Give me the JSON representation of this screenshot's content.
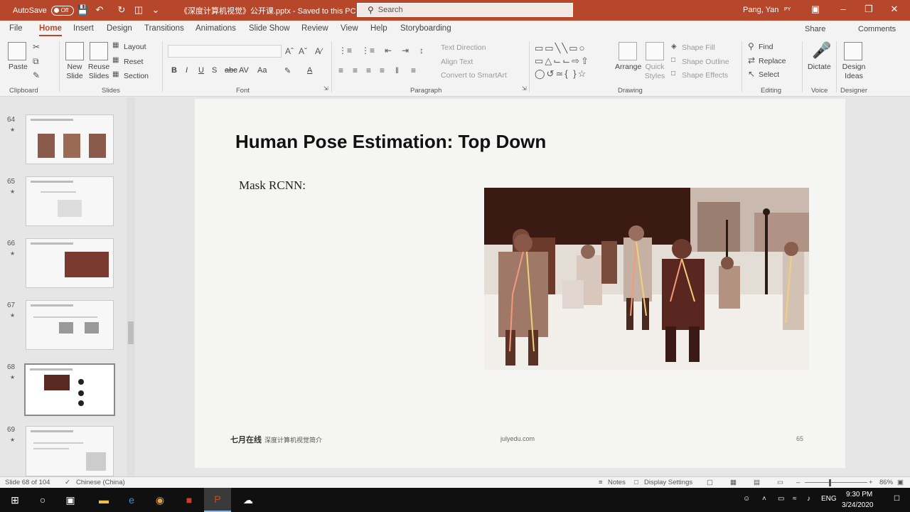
{
  "titlebar": {
    "autosave_label": "AutoSave",
    "autosave_state": "Off",
    "doc_title": "《深度计算机视觉》公开课.pptx  -  Saved to this PC",
    "search_placeholder": "Search",
    "user_name": "Pang, Yan",
    "user_initials": "PY"
  },
  "tabs": [
    "File",
    "Home",
    "Insert",
    "Design",
    "Transitions",
    "Animations",
    "Slide Show",
    "Review",
    "View",
    "Help",
    "Storyboarding"
  ],
  "share": {
    "share_label": "Share",
    "comments_label": "Comments"
  },
  "ribbon": {
    "clipboard": {
      "paste": "Paste",
      "label": "Clipboard"
    },
    "slides": {
      "new_slide": "New Slide",
      "reuse_slides": "Reuse Slides",
      "layout": "Layout",
      "reset": "Reset",
      "section": "Section",
      "label": "Slides"
    },
    "font": {
      "label": "Font"
    },
    "paragraph": {
      "text_direction": "Text Direction",
      "align_text": "Align Text",
      "convert_smartart": "Convert to SmartArt",
      "label": "Paragraph"
    },
    "drawing": {
      "arrange": "Arrange",
      "quick_styles": "Quick Styles",
      "shape_fill": "Shape Fill",
      "shape_outline": "Shape Outline",
      "shape_effects": "Shape Effects",
      "label": "Drawing"
    },
    "editing": {
      "find": "Find",
      "replace": "Replace",
      "select": "Select",
      "label": "Editing"
    },
    "voice": {
      "dictate": "Dictate",
      "label": "Voice"
    },
    "designer": {
      "design_ideas": "Design Ideas",
      "label": "Designer"
    }
  },
  "thumbnails": [
    {
      "num": "64",
      "star": "★"
    },
    {
      "num": "65",
      "star": "★"
    },
    {
      "num": "66",
      "star": "★"
    },
    {
      "num": "67",
      "star": "★"
    },
    {
      "num": "68",
      "star": "★"
    },
    {
      "num": "69",
      "star": "★"
    }
  ],
  "slide": {
    "title": "Human Pose Estimation: Top Down",
    "body": "Mask RCNN:",
    "footer_logo": "七月在线",
    "footer_logo_sub": "深度计算机视觉简介",
    "footer_url": "julyedu.com",
    "footer_page": "65"
  },
  "statusbar": {
    "slide_info": "Slide 68 of 104",
    "language": "Chinese (China)",
    "notes": "Notes",
    "display_settings": "Display Settings",
    "zoom": "86%"
  },
  "taskbar": {
    "input_lang": "ENG",
    "time": "9:30 PM",
    "date": "3/24/2020"
  },
  "colors": {
    "accent": "#b7472a",
    "taskbar": "#101010"
  }
}
